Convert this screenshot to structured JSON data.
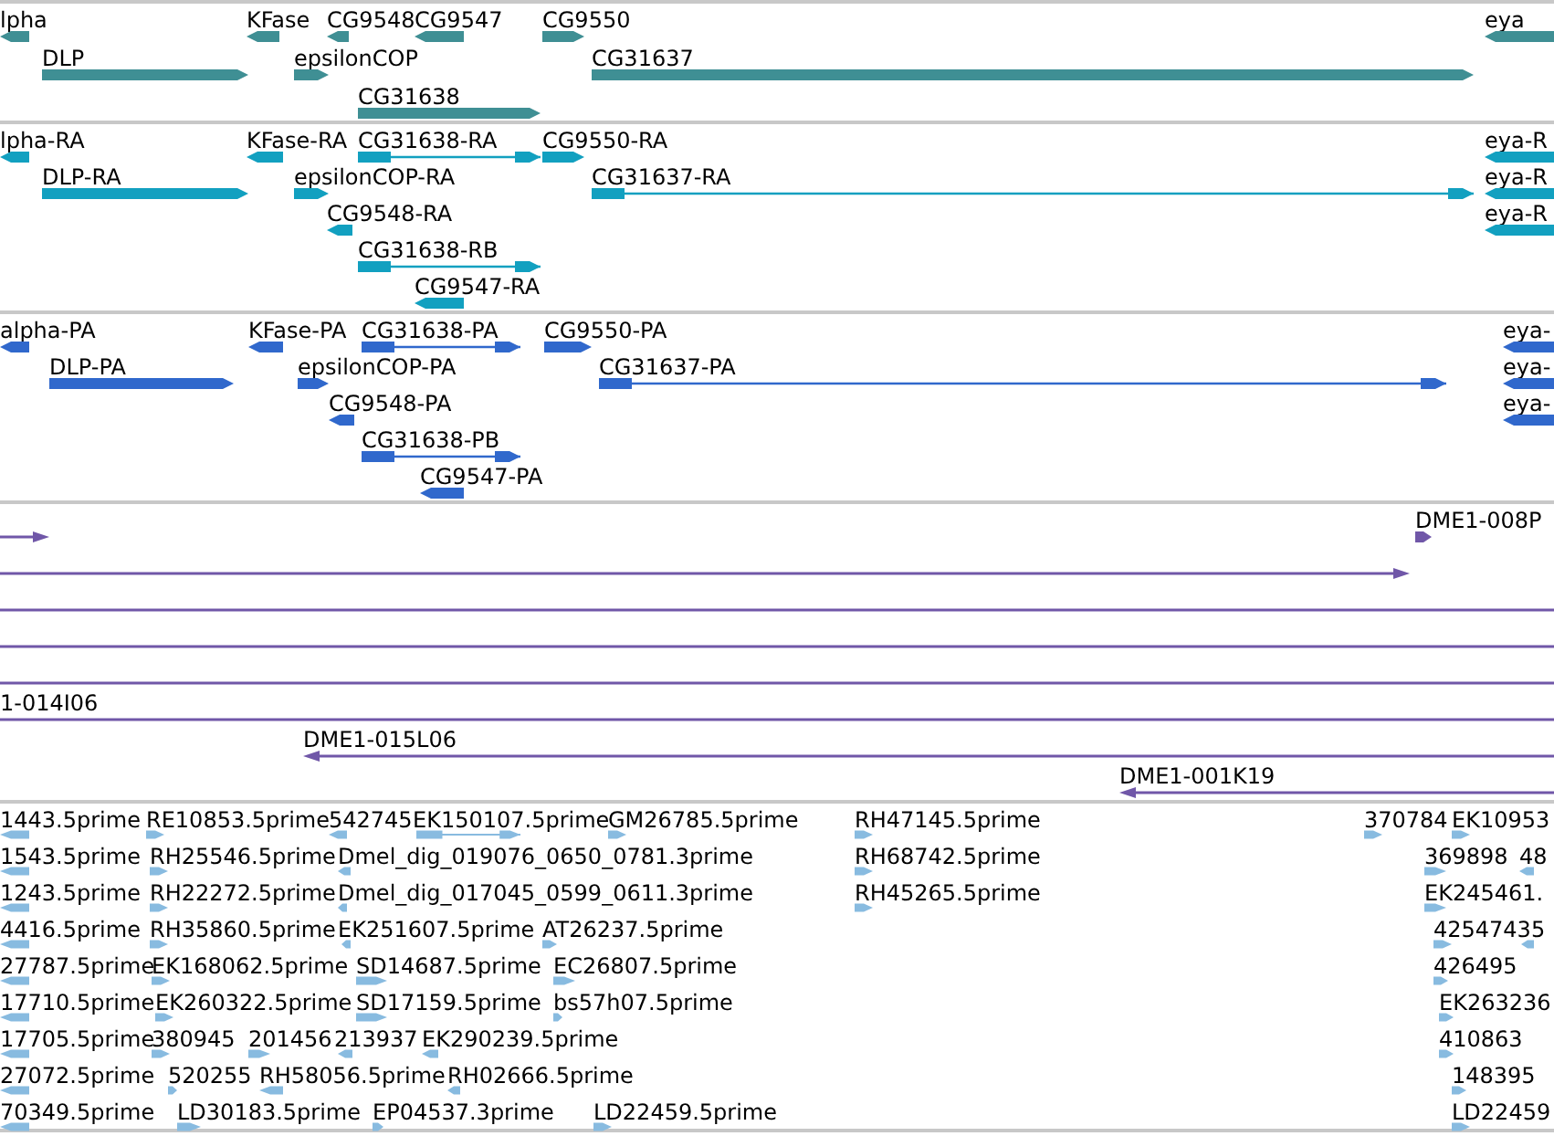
{
  "tracks": [
    {
      "kind": "gene",
      "color": "#3f8f94",
      "features": [
        {
          "label": "lpha",
          "kind": "block",
          "reverse": true
        },
        {
          "label": "KFase",
          "kind": "block",
          "reverse": true
        },
        {
          "label": "CG9548",
          "kind": "block",
          "reverse": true
        },
        {
          "label": "CG9547",
          "kind": "block",
          "reverse": true
        },
        {
          "label": "CG9550",
          "kind": "block",
          "reverse": false
        },
        {
          "label": "eya",
          "kind": "block",
          "reverse": true
        },
        {
          "label": "DLP",
          "kind": "block",
          "reverse": false
        },
        {
          "label": "epsilonCOP",
          "kind": "block",
          "reverse": false
        },
        {
          "label": "CG31637",
          "kind": "block",
          "reverse": false
        },
        {
          "label": "CG31638",
          "kind": "block",
          "reverse": false
        }
      ]
    },
    {
      "kind": "transcript",
      "color": "#12a0c0",
      "features": [
        {
          "label": "lpha-RA",
          "kind": "block",
          "reverse": true
        },
        {
          "label": "KFase-RA",
          "kind": "block",
          "reverse": true
        },
        {
          "label": "CG31638-RA",
          "kind": "spliced",
          "reverse": false
        },
        {
          "label": "CG9550-RA",
          "kind": "block",
          "reverse": false
        },
        {
          "label": "eya-R",
          "kind": "block",
          "reverse": true
        },
        {
          "label": "DLP-RA",
          "kind": "block",
          "reverse": false
        },
        {
          "label": "epsilonCOP-RA",
          "kind": "block",
          "reverse": false
        },
        {
          "label": "CG31637-RA",
          "kind": "spliced",
          "reverse": false
        },
        {
          "label": "eya-R",
          "kind": "block",
          "reverse": true
        },
        {
          "label": "CG9548-RA",
          "kind": "block",
          "reverse": true
        },
        {
          "label": "eya-R",
          "kind": "block",
          "reverse": true
        },
        {
          "label": "CG31638-RB",
          "kind": "spliced",
          "reverse": false
        },
        {
          "label": "CG9547-RA",
          "kind": "block",
          "reverse": true
        }
      ]
    },
    {
      "kind": "protein",
      "color": "#3068cc",
      "features": [
        {
          "label": "alpha-PA",
          "kind": "block",
          "reverse": true
        },
        {
          "label": "KFase-PA",
          "kind": "block",
          "reverse": true
        },
        {
          "label": "CG31638-PA",
          "kind": "spliced",
          "reverse": false
        },
        {
          "label": "CG9550-PA",
          "kind": "block",
          "reverse": false
        },
        {
          "label": "eya-",
          "kind": "block",
          "reverse": true
        },
        {
          "label": "DLP-PA",
          "kind": "block",
          "reverse": false
        },
        {
          "label": "epsilonCOP-PA",
          "kind": "block",
          "reverse": false
        },
        {
          "label": "CG31637-PA",
          "kind": "spliced",
          "reverse": false
        },
        {
          "label": "eya-",
          "kind": "block",
          "reverse": true
        },
        {
          "label": "CG9548-PA",
          "kind": "block",
          "reverse": true
        },
        {
          "label": "eya-",
          "kind": "block",
          "reverse": true
        },
        {
          "label": "CG31638-PB",
          "kind": "spliced",
          "reverse": false
        },
        {
          "label": "CG9547-PA",
          "kind": "block",
          "reverse": true
        }
      ]
    },
    {
      "kind": "clone",
      "color": "#7057a8",
      "features": [
        {
          "kind": "line",
          "reverse": false
        },
        {
          "label": "DME1-008P",
          "kind": "block",
          "reverse": false
        },
        {
          "kind": "line",
          "reverse": false
        },
        {
          "kind": "bare"
        },
        {
          "kind": "bare"
        },
        {
          "kind": "bare"
        },
        {
          "label": "1-014I06",
          "kind": "bare"
        },
        {
          "label": "DME1-015L06",
          "kind": "line",
          "reverse": true
        },
        {
          "label": "DME1-001K19",
          "kind": "line",
          "reverse": true
        }
      ]
    },
    {
      "kind": "est",
      "color": "#88bbe0",
      "features": [
        {
          "label": "1443.5prime",
          "kind": "block",
          "reverse": true
        },
        {
          "label": "RE10853.5prime",
          "kind": "block",
          "reverse": false
        },
        {
          "label": "542745",
          "kind": "block",
          "reverse": true
        },
        {
          "label": "EK150107.5prime",
          "kind": "spliced",
          "reverse": false
        },
        {
          "label": "GM26785.5prime",
          "kind": "block",
          "reverse": false
        },
        {
          "label": "RH47145.5prime",
          "kind": "block",
          "reverse": false
        },
        {
          "label": "370784",
          "kind": "block",
          "reverse": false
        },
        {
          "label": "EK10953",
          "kind": "block",
          "reverse": false
        },
        {
          "label": "1543.5prime",
          "kind": "block",
          "reverse": true
        },
        {
          "label": "RH25546.5prime",
          "kind": "block",
          "reverse": false
        },
        {
          "label": "Dmel_dig_019076_0650_0781.3prime",
          "kind": "block",
          "reverse": true
        },
        {
          "label": "RH68742.5prime",
          "kind": "block",
          "reverse": false
        },
        {
          "label": "369898",
          "kind": "block",
          "reverse": false
        },
        {
          "label": "48",
          "kind": "block",
          "reverse": true
        },
        {
          "label": "1243.5prime",
          "kind": "block",
          "reverse": true
        },
        {
          "label": "RH22272.5prime",
          "kind": "block",
          "reverse": false
        },
        {
          "label": "Dmel_dig_017045_0599_0611.3prime",
          "kind": "block",
          "reverse": true
        },
        {
          "label": "RH45265.5prime",
          "kind": "block",
          "reverse": false
        },
        {
          "label": "EK245461.",
          "kind": "block",
          "reverse": false
        },
        {
          "label": "4416.5prime",
          "kind": "block",
          "reverse": true
        },
        {
          "label": "RH35860.5prime",
          "kind": "block",
          "reverse": false
        },
        {
          "label": "EK251607.5prime",
          "kind": "block",
          "reverse": true
        },
        {
          "label": "AT26237.5prime",
          "kind": "block",
          "reverse": false
        },
        {
          "label": "42547435",
          "kind": "block",
          "reverse": false
        },
        {
          "kind": "block",
          "reverse": true
        },
        {
          "label": "27787.5prime",
          "kind": "block",
          "reverse": true
        },
        {
          "label": "EK168062.5prime",
          "kind": "block",
          "reverse": false
        },
        {
          "label": "SD14687.5prime",
          "kind": "block",
          "reverse": false
        },
        {
          "label": "EC26807.5prime",
          "kind": "block",
          "reverse": false
        },
        {
          "label": "426495",
          "kind": "block",
          "reverse": false
        },
        {
          "label": "17710.5prime",
          "kind": "block",
          "reverse": true
        },
        {
          "label": "EK260322.5prime",
          "kind": "block",
          "reverse": false
        },
        {
          "label": "SD17159.5prime",
          "kind": "block",
          "reverse": false
        },
        {
          "label": "bs57h07.5prime",
          "kind": "block",
          "reverse": false
        },
        {
          "label": "EK263236",
          "kind": "block",
          "reverse": false
        },
        {
          "label": "17705.5prime",
          "kind": "block",
          "reverse": true
        },
        {
          "label": "380945",
          "kind": "block",
          "reverse": false
        },
        {
          "label": "201456",
          "kind": "block",
          "reverse": false
        },
        {
          "label": "213937",
          "kind": "block",
          "reverse": true
        },
        {
          "label": "EK290239.5prime",
          "kind": "block",
          "reverse": true
        },
        {
          "label": "410863",
          "kind": "block",
          "reverse": false
        },
        {
          "label": "27072.5prime",
          "kind": "block",
          "reverse": true
        },
        {
          "label": "520255",
          "kind": "block",
          "reverse": false
        },
        {
          "label": "RH58056.5prime",
          "kind": "block",
          "reverse": true
        },
        {
          "label": "RH02666.5prime",
          "kind": "block",
          "reverse": true
        },
        {
          "label": "148395",
          "kind": "block",
          "reverse": false
        },
        {
          "label": "70349.5prime",
          "kind": "block",
          "reverse": true
        },
        {
          "label": "LD30183.5prime",
          "kind": "block",
          "reverse": false
        },
        {
          "label": "EP04537.3prime",
          "kind": "block",
          "reverse": false
        },
        {
          "label": "LD22459.5prime",
          "kind": "block",
          "reverse": false
        },
        {
          "label": "LD22459",
          "kind": "block",
          "reverse": false
        }
      ]
    }
  ]
}
